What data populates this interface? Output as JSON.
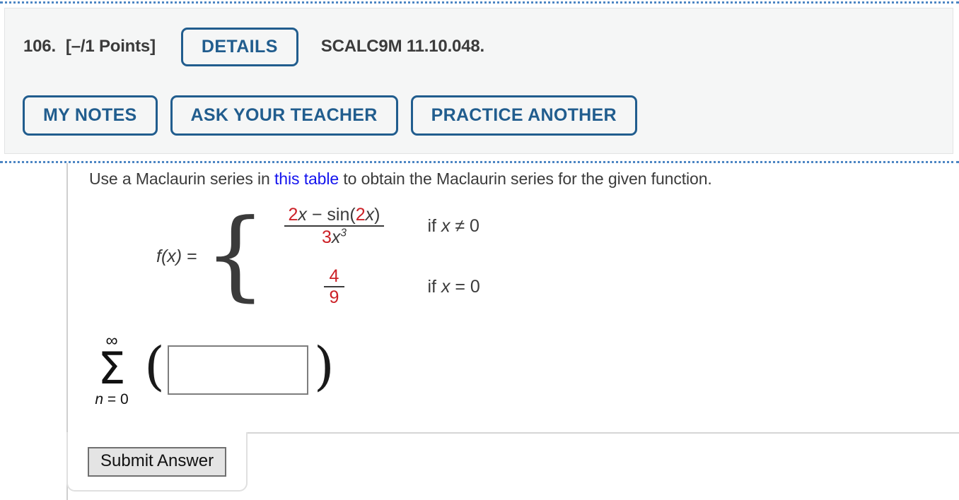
{
  "header": {
    "question_number": "106.",
    "points": "[–/1 Points]",
    "details_label": "DETAILS",
    "reference": "SCALC9M 11.10.048.",
    "actions": [
      {
        "label": "MY NOTES"
      },
      {
        "label": "ASK YOUR TEACHER"
      },
      {
        "label": "PRACTICE ANOTHER"
      }
    ],
    "accent_color": "#215d8e",
    "panel_background": "#f5f6f6"
  },
  "instruction": {
    "before_link": "Use a Maclaurin series in ",
    "link_text": "this table",
    "after_link": " to obtain the Maclaurin series for the given function.",
    "link_color": "#1414ee"
  },
  "formula": {
    "function_name": "f(x)",
    "equals": "=",
    "highlight_color": "#cc2127",
    "case1": {
      "numerator": {
        "coef": "2",
        "var": "x",
        "operator": "−",
        "fn": "sin(",
        "inner_coef": "2",
        "inner_var": "x",
        "close": ")"
      },
      "denominator": {
        "coef": "3",
        "var": "x",
        "exponent": "3"
      },
      "condition": "if x ≠ 0",
      "condition_prefix": "if ",
      "condition_var": "x",
      "condition_suffix": " ≠ 0"
    },
    "case2": {
      "numerator": "4",
      "denominator": "9",
      "condition_prefix": "if ",
      "condition_var": "x",
      "condition_suffix": " = 0"
    }
  },
  "answer": {
    "sigma_symbol": "Σ",
    "upper_limit": "∞",
    "lower_index": "n",
    "lower_equals": " = ",
    "lower_value": "0",
    "paren_open": "(",
    "paren_close": ")",
    "input_value": "",
    "input_placeholder": ""
  },
  "footer": {
    "submit_label": "Submit Answer"
  }
}
